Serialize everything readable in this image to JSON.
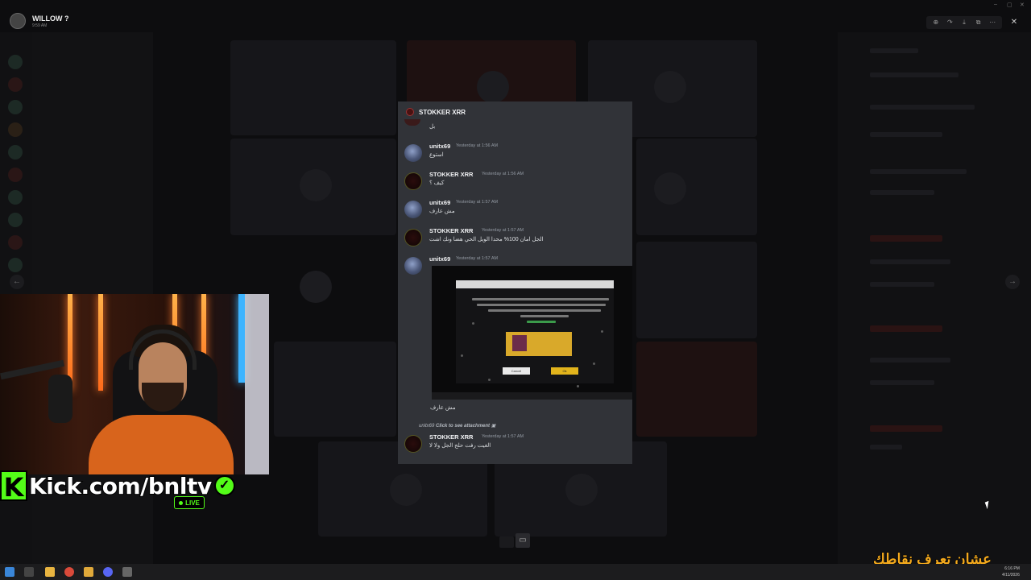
{
  "header": {
    "user_name": "WILLOW ?",
    "time": "9:59 AM"
  },
  "toolbar": {
    "icons": [
      "zoom-icon",
      "forward-icon",
      "download-icon",
      "open-external-icon",
      "more-icon"
    ],
    "zoom": "⊕",
    "forward": "↷",
    "download": "⤓",
    "external": "⧉",
    "more": "⋯",
    "close": "✕"
  },
  "nav": {
    "prev": "←",
    "next": "→"
  },
  "modal": {
    "title": "STOKKER XRR",
    "first_text": "بل",
    "messages": [
      {
        "author": "unitx69",
        "time": "Yesterday at 1:56 AM",
        "text": "استوع",
        "avatar": "unit"
      },
      {
        "author": "STOKKER XRR",
        "time": "Yesterday at 1:56 AM",
        "text": "كيف ؟",
        "avatar": "stk"
      },
      {
        "author": "unitx69",
        "time": "Yesterday at 1:57 AM",
        "text": "مش عارف",
        "avatar": "unit"
      },
      {
        "author": "STOKKER XRR",
        "time": "Yesterday at 1:57 AM",
        "text": "الجل امان 100% محدا الويل الحي هضا ونك اشت",
        "avatar": "stk"
      },
      {
        "author": "unitx69",
        "time": "Yesterday at 1:57 AM",
        "text": "",
        "avatar": "unit"
      }
    ],
    "after_attachment_text": "مش عارف",
    "reply": {
      "author": "unitx69",
      "action": "Click to see attachment"
    },
    "last_message": {
      "author": "STOKKER XRR",
      "time": "Yesterday at 1:57 AM",
      "text": "الغيت رفت حلج الجل ولا لا"
    }
  },
  "attachment": {
    "cancel_label": "Cancel",
    "ok_label": "Ok"
  },
  "stream": {
    "kick_logo": "K",
    "kick_url": "Kick.com/bnltv",
    "verified": "✓",
    "live_label": "LIVE",
    "overlay_text": "عشان تعرف نقاطك"
  },
  "taskbar": {
    "time": "6:16 PM",
    "date": "4/11/2026"
  },
  "colors": {
    "kick_green": "#53fc18",
    "overlay_orange": "#f2a81d",
    "modal_bg": "#313338"
  }
}
